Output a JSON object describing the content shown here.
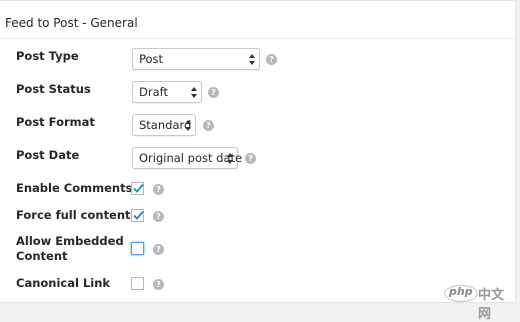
{
  "panel": {
    "title": "Feed to Post - General"
  },
  "fields": {
    "post_type": {
      "label": "Post Type",
      "value": "Post",
      "help": "?"
    },
    "post_status": {
      "label": "Post Status",
      "value": "Draft",
      "help": "?"
    },
    "post_format": {
      "label": "Post Format",
      "value": "Standard",
      "help": "?"
    },
    "post_date": {
      "label": "Post Date",
      "value": "Original post date",
      "help": "?"
    },
    "enable_comments": {
      "label": "Enable Comments",
      "checked": true,
      "help": "?"
    },
    "force_full_content": {
      "label": "Force full content",
      "checked": true,
      "help": "?"
    },
    "allow_embedded_content": {
      "label_line1": "Allow Embedded",
      "label_line2": "Content",
      "checked": false,
      "focused": true,
      "help": "?"
    },
    "canonical_link": {
      "label": "Canonical Link",
      "checked": false,
      "help": "?"
    }
  },
  "watermark": {
    "logo": "php",
    "text": "中文网"
  },
  "colors": {
    "help_icon": "#b4b9be",
    "checkmark": "#1e8cbe",
    "focus_ring": "#5b9dd9"
  }
}
